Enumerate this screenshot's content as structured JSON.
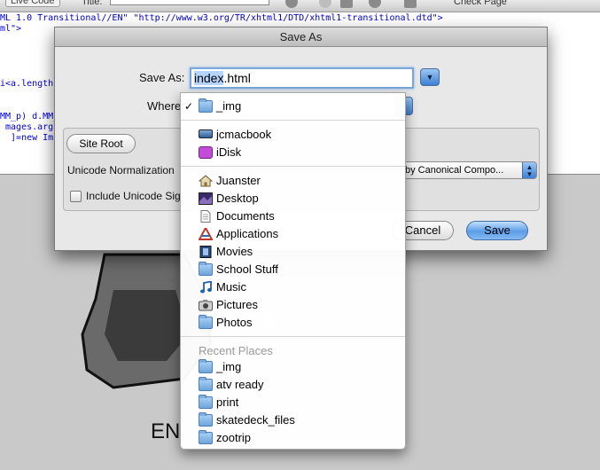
{
  "toolbar": {
    "live_code_label": "Live Code",
    "title_label": "Title:",
    "check_page_label": "Check Page"
  },
  "code": {
    "lines": [
      "ML 1.0 Transitional//EN\" \"http://www.w3.org/TR/xhtml1/DTD/xhtml1-transitional.dtd\">",
      "ml\">",
      "",
      "",
      "i<a.length",
      "",
      "",
      "MM_p) d.MM_",
      " mages.argu",
      "  ]=new Imag"
    ]
  },
  "background": {
    "art_text": "EN"
  },
  "dialog": {
    "title": "Save As",
    "save_as_label": "Save As:",
    "filename_base": "index",
    "filename_ext": ".html",
    "where_label": "Where",
    "site_root_label": "Site Root",
    "unicode_label": "Unicode Normalization",
    "unicode_value": "by Canonical Compo...",
    "include_label": "Include Unicode Sig",
    "include_checked": false,
    "cancel_label": "Cancel",
    "save_label": "Save"
  },
  "menu": {
    "selected": {
      "label": "_img",
      "icon": "folder-icon",
      "checked": true
    },
    "devices": [
      {
        "label": "jcmacbook",
        "icon": "computer-icon"
      },
      {
        "label": "iDisk",
        "icon": "idisk-icon"
      }
    ],
    "places": [
      {
        "label": "Juanster",
        "icon": "home-icon"
      },
      {
        "label": "Desktop",
        "icon": "desktop-icon"
      },
      {
        "label": "Documents",
        "icon": "documents-icon"
      },
      {
        "label": "Applications",
        "icon": "applications-icon"
      },
      {
        "label": "Movies",
        "icon": "movies-icon"
      },
      {
        "label": "School Stuff",
        "icon": "folder-icon"
      },
      {
        "label": "Music",
        "icon": "music-icon"
      },
      {
        "label": "Pictures",
        "icon": "pictures-icon"
      },
      {
        "label": "Photos",
        "icon": "folder-icon"
      }
    ],
    "recent_header": "Recent Places",
    "recent": [
      {
        "label": "_img",
        "icon": "folder-icon"
      },
      {
        "label": "atv ready",
        "icon": "folder-icon"
      },
      {
        "label": "print",
        "icon": "folder-icon"
      },
      {
        "label": "skatedeck_files",
        "icon": "folder-icon"
      },
      {
        "label": "zootrip",
        "icon": "folder-icon"
      }
    ]
  },
  "colors": {
    "accent": "#3d7fd2",
    "selection": "#b5d5ff",
    "focus_ring": "#7aa6d9"
  }
}
